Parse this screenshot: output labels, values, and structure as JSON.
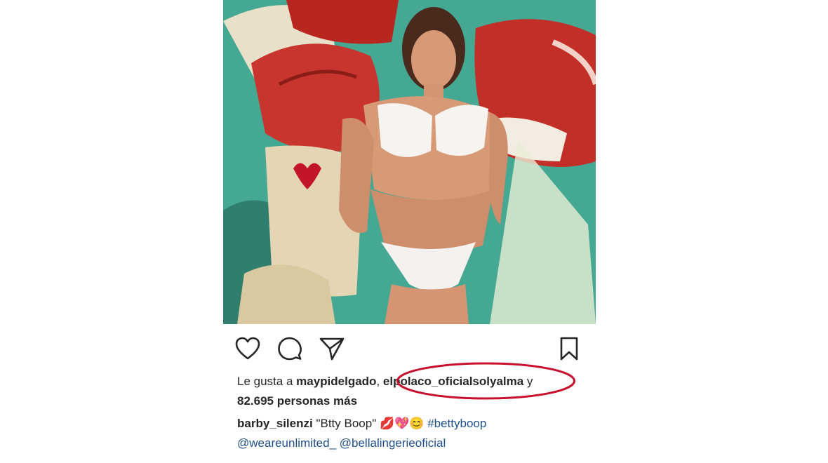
{
  "post": {
    "photo_alt": "Betty Boop mural photo",
    "actions": {
      "like_icon": "heart-outline-icon",
      "comment_icon": "comment-bubble-icon",
      "share_icon": "paper-plane-icon",
      "save_icon": "bookmark-icon"
    },
    "likes": {
      "prefix": "Le gusta a ",
      "user1": "maypidelgado",
      "separator": ", ",
      "user2": "elpolaco_oficialsolyalma",
      "trailing": " y",
      "count_text": "82.695 personas más"
    },
    "caption": {
      "author": "barby_silenzi",
      "text": " \"Btty Boop\" ",
      "emojis": "💋💖😊",
      "hashtag": " #bettyboop",
      "mention1": "@weareunlimited_",
      "mention2": " @bellalingerieoficial"
    }
  },
  "colors": {
    "text": "#262626",
    "link": "#1e4f8a",
    "highlight": "#c8102e"
  }
}
